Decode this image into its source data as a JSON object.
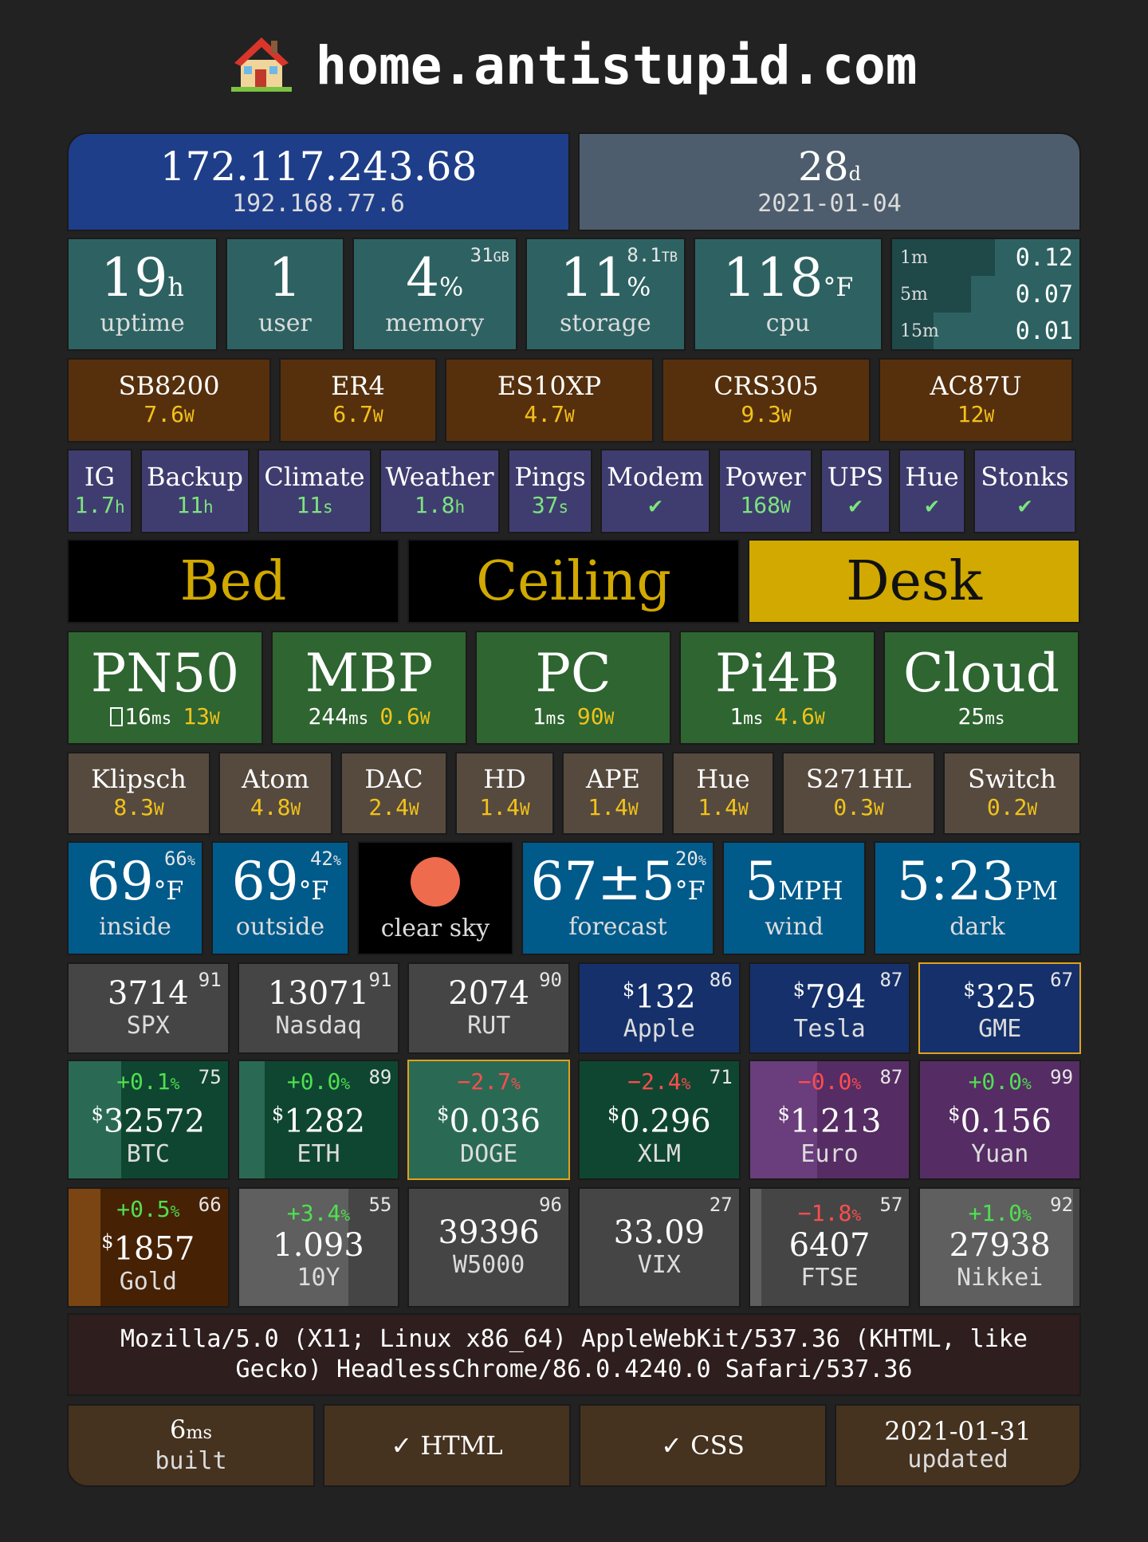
{
  "header": {
    "icon": "house-icon",
    "title": "home.antistupid.com"
  },
  "network": {
    "public_ip": "172.117.243.68",
    "local_ip": "192.168.77.6",
    "days": "28",
    "days_unit": "d",
    "date": "2021-01-04"
  },
  "system": {
    "uptime": {
      "value": "19",
      "unit": "h",
      "label": "uptime"
    },
    "user": {
      "value": "1",
      "label": "user"
    },
    "memory": {
      "value": "4",
      "unit": "%",
      "label": "memory",
      "corner": "31",
      "corner_unit": "GB"
    },
    "storage": {
      "value": "11",
      "unit": "%",
      "label": "storage",
      "corner": "8.1",
      "corner_unit": "TB"
    },
    "cpu": {
      "value": "118",
      "unit": "°F",
      "label": "cpu"
    },
    "load": [
      {
        "label": "1m",
        "value": "0.12",
        "fraction": 0.55
      },
      {
        "label": "5m",
        "value": "0.07",
        "fraction": 0.42
      },
      {
        "label": "15m",
        "value": "0.01",
        "fraction": 0.22
      }
    ]
  },
  "network_devices": [
    {
      "name": "SB8200",
      "value": "7.6",
      "unit": "W"
    },
    {
      "name": "ER4",
      "value": "6.7",
      "unit": "W"
    },
    {
      "name": "ES10XP",
      "value": "4.7",
      "unit": "W"
    },
    {
      "name": "CRS305",
      "value": "9.3",
      "unit": "W"
    },
    {
      "name": "AC87U",
      "value": "12",
      "unit": "W"
    }
  ],
  "services": [
    {
      "name": "IG",
      "value": "1.7",
      "unit": "h"
    },
    {
      "name": "Backup",
      "value": "11",
      "unit": "h"
    },
    {
      "name": "Climate",
      "value": "11",
      "unit": "s"
    },
    {
      "name": "Weather",
      "value": "1.8",
      "unit": "h"
    },
    {
      "name": "Pings",
      "value": "37",
      "unit": "s"
    },
    {
      "name": "Modem",
      "value": "✔",
      "unit": ""
    },
    {
      "name": "Power",
      "value": "168",
      "unit": "W"
    },
    {
      "name": "UPS",
      "value": "✔",
      "unit": ""
    },
    {
      "name": "Hue",
      "value": "✔",
      "unit": ""
    },
    {
      "name": "Stonks",
      "value": "✔",
      "unit": ""
    }
  ],
  "lights": [
    {
      "name": "Bed",
      "on": false
    },
    {
      "name": "Ceiling",
      "on": false
    },
    {
      "name": "Desk",
      "on": true
    }
  ],
  "colors": {
    "light_on_bg": "#d1a900",
    "light_off_text": "#d1a900",
    "light_off_bg": "#000000"
  },
  "hosts": [
    {
      "name": "PN50",
      "prefix": "",
      "ping": "16",
      "ping_unit": "ms",
      "power": "13",
      "power_unit": "W"
    },
    {
      "name": "MBP",
      "ping": "244",
      "ping_unit": "ms",
      "power": "0.6",
      "power_unit": "W"
    },
    {
      "name": "PC",
      "ping": "1",
      "ping_unit": "ms",
      "power": "90",
      "power_unit": "W"
    },
    {
      "name": "Pi4B",
      "ping": "1",
      "ping_unit": "ms",
      "power": "4.6",
      "power_unit": "W"
    },
    {
      "name": "Cloud",
      "ping": "25",
      "ping_unit": "ms",
      "power": "",
      "power_unit": ""
    }
  ],
  "devices": [
    {
      "name": "Klipsch",
      "value": "8.3",
      "unit": "W"
    },
    {
      "name": "Atom",
      "value": "4.8",
      "unit": "W"
    },
    {
      "name": "DAC",
      "value": "2.4",
      "unit": "W"
    },
    {
      "name": "HD",
      "value": "1.4",
      "unit": "W"
    },
    {
      "name": "APE",
      "value": "1.4",
      "unit": "W"
    },
    {
      "name": "Hue",
      "value": "1.4",
      "unit": "W"
    },
    {
      "name": "S271HL",
      "value": "0.3",
      "unit": "W"
    },
    {
      "name": "Switch",
      "value": "0.2",
      "unit": "W"
    }
  ],
  "weather": {
    "inside": {
      "value": "69",
      "unit": "°F",
      "label": "inside",
      "corner": "66",
      "corner_unit": "%"
    },
    "outside": {
      "value": "69",
      "unit": "°F",
      "label": "outside",
      "corner": "42",
      "corner_unit": "%"
    },
    "sky": {
      "label": "clear sky",
      "icon": "sun-icon"
    },
    "forecast": {
      "value": "67±5",
      "unit": "°F",
      "label": "forecast",
      "corner": "20",
      "corner_unit": "%"
    },
    "wind": {
      "value": "5",
      "unit": "MPH",
      "label": "wind"
    },
    "time": {
      "value": "5:23",
      "unit": "PM",
      "label": "dark"
    }
  },
  "markets": {
    "row1": [
      {
        "value": "3714",
        "dollar": "",
        "label": "SPX",
        "corner": "91",
        "change": ""
      },
      {
        "value": "13071",
        "dollar": "",
        "label": "Nasdaq",
        "corner": "91",
        "change": ""
      },
      {
        "value": "2074",
        "dollar": "",
        "label": "RUT",
        "corner": "90",
        "change": ""
      },
      {
        "value": "132",
        "dollar": "$",
        "label": "Apple",
        "corner": "86",
        "change": ""
      },
      {
        "value": "794",
        "dollar": "$",
        "label": "Tesla",
        "corner": "87",
        "change": ""
      },
      {
        "value": "325",
        "dollar": "$",
        "label": "GME",
        "corner": "67",
        "change": ""
      }
    ],
    "row2": [
      {
        "value": "32572",
        "dollar": "$",
        "label": "BTC",
        "corner": "75",
        "change": "+0.1",
        "change_unit": "%"
      },
      {
        "value": "1282",
        "dollar": "$",
        "label": "ETH",
        "corner": "89",
        "change": "+0.0",
        "change_unit": "%"
      },
      {
        "value": "0.036",
        "dollar": "$",
        "label": "DOGE",
        "corner": "",
        "change": "−2.7",
        "change_unit": "%"
      },
      {
        "value": "0.296",
        "dollar": "$",
        "label": "XLM",
        "corner": "71",
        "change": "−2.4",
        "change_unit": "%"
      },
      {
        "value": "1.213",
        "dollar": "$",
        "label": "Euro",
        "corner": "87",
        "change": "−0.0",
        "change_unit": "%"
      },
      {
        "value": "0.156",
        "dollar": "$",
        "label": "Yuan",
        "corner": "99",
        "change": "+0.0",
        "change_unit": "%"
      }
    ],
    "row3": [
      {
        "value": "1857",
        "dollar": "$",
        "label": "Gold",
        "corner": "66",
        "change": "+0.5",
        "change_unit": "%"
      },
      {
        "value": "1.093",
        "dollar": "",
        "label": "10Y",
        "corner": "55",
        "change": "+3.4",
        "change_unit": "%"
      },
      {
        "value": "39396",
        "dollar": "",
        "label": "W5000",
        "corner": "96",
        "change": ""
      },
      {
        "value": "33.09",
        "dollar": "",
        "label": "VIX",
        "corner": "27",
        "change": ""
      },
      {
        "value": "6407",
        "dollar": "",
        "label": "FTSE",
        "corner": "57",
        "change": "−1.8",
        "change_unit": "%"
      },
      {
        "value": "27938",
        "dollar": "",
        "label": "Nikkei",
        "corner": "92",
        "change": "+1.0",
        "change_unit": "%"
      }
    ]
  },
  "user_agent": "Mozilla/5.0 (X11; Linux x86_64) AppleWebKit/537.36 (KHTML, like Gecko) HeadlessChrome/86.0.4240.0 Safari/537.36",
  "footer": {
    "built_value": "6",
    "built_unit": "ms",
    "built_label": "built",
    "html_label": "✓ HTML",
    "css_label": "✓ CSS",
    "updated_date": "2021-01-31",
    "updated_label": "updated"
  }
}
